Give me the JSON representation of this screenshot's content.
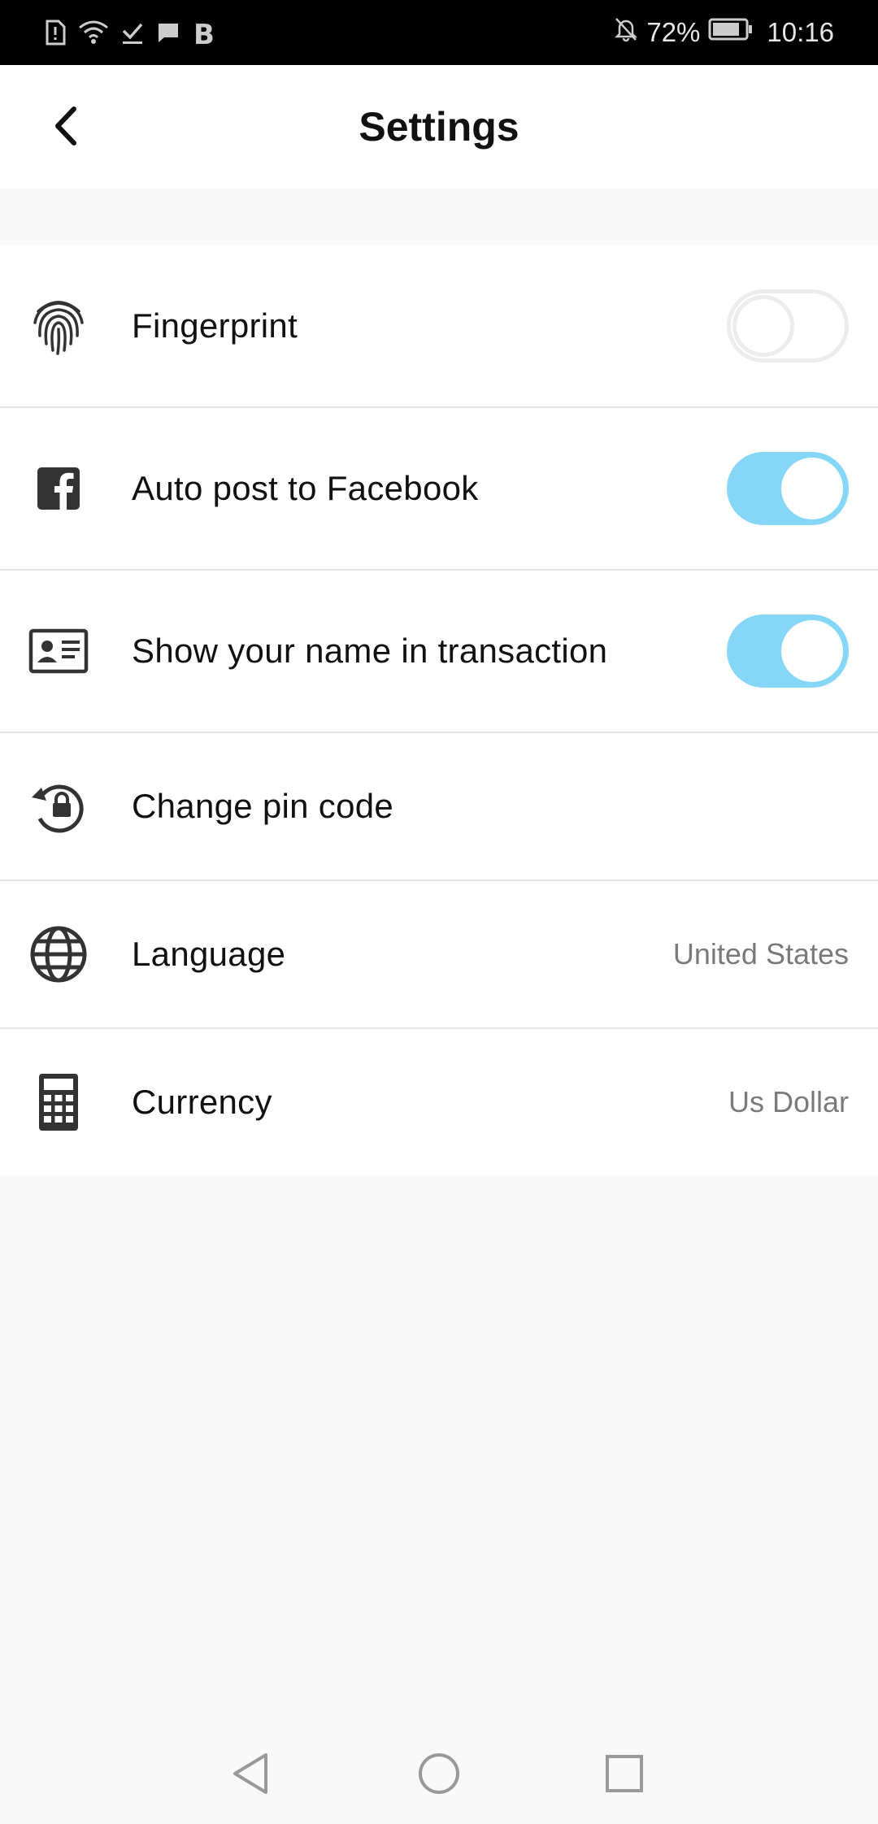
{
  "status_bar": {
    "battery_percent": "72%",
    "time": "10:16",
    "left_icons": [
      "sim-alert-icon",
      "wifi-icon",
      "download-done-icon",
      "message-icon",
      "b-app-icon"
    ],
    "right_icons": [
      "bell-off-icon",
      "battery-icon"
    ]
  },
  "header": {
    "title": "Settings",
    "back_icon": "chevron-left-icon"
  },
  "settings": {
    "fingerprint": {
      "label": "Fingerprint",
      "icon": "fingerprint-icon",
      "toggle_on": false
    },
    "facebook": {
      "label": "Auto post to Facebook",
      "icon": "facebook-icon",
      "toggle_on": true
    },
    "show_name": {
      "label": "Show your name in transaction",
      "icon": "id-card-icon",
      "toggle_on": true
    },
    "pin": {
      "label": "Change pin code",
      "icon": "lock-reset-icon"
    },
    "language": {
      "label": "Language",
      "value": "United States",
      "icon": "globe-icon"
    },
    "currency": {
      "label": "Currency",
      "value": "Us Dollar",
      "icon": "calculator-icon"
    }
  },
  "colors": {
    "toggle_on": "#86d6f7",
    "toggle_off_border": "#ececec",
    "page_background": "#f9f9f9",
    "divider": "#e6e6e6"
  },
  "nav_bar": {
    "icons": [
      "nav-back-icon",
      "nav-home-icon",
      "nav-recents-icon"
    ]
  }
}
